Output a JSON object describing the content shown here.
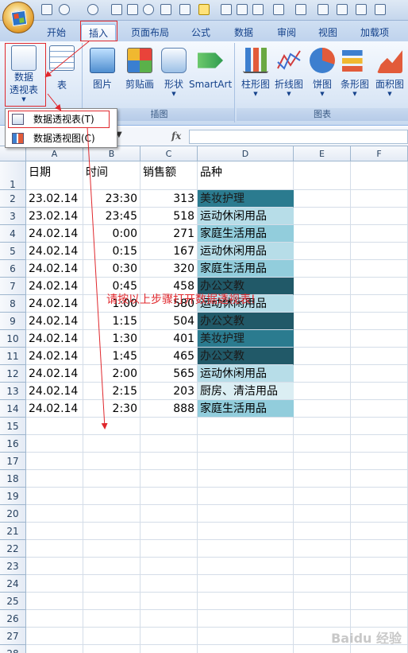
{
  "ribbon_tabs": [
    "开始",
    "插入",
    "页面布局",
    "公式",
    "数据",
    "审阅",
    "视图",
    "加载项"
  ],
  "active_tab": "插入",
  "groups": {
    "tables": {
      "pivot_label_1": "数据",
      "pivot_label_2": "透视表",
      "table_label": "表"
    },
    "illustrations": {
      "label": "插图",
      "items": [
        "图片",
        "剪贴画",
        "形状",
        "SmartArt"
      ]
    },
    "charts": {
      "label": "图表",
      "items": [
        "柱形图",
        "折线图",
        "饼图",
        "条形图",
        "面积图"
      ]
    }
  },
  "dropdown": {
    "items": [
      "数据透视表(T)",
      "数据透视图(C)"
    ]
  },
  "formula_bar": {
    "fx": "fx",
    "value": ""
  },
  "columns": [
    "A",
    "B",
    "C",
    "D",
    "E",
    "F"
  ],
  "sheet": {
    "header": [
      "日期",
      "时间",
      "销售额",
      "品种"
    ],
    "rows": [
      [
        "23.02.14",
        "23:30",
        "313",
        "美妆护理"
      ],
      [
        "23.02.14",
        "23:45",
        "518",
        "运动休闲用品"
      ],
      [
        "24.02.14",
        "0:00",
        "271",
        "家庭生活用品"
      ],
      [
        "24.02.14",
        "0:15",
        "167",
        "运动休闲用品"
      ],
      [
        "24.02.14",
        "0:30",
        "320",
        "家庭生活用品"
      ],
      [
        "24.02.14",
        "0:45",
        "458",
        "办公文教"
      ],
      [
        "24.02.14",
        "1:00",
        "580",
        "运动休闲用品"
      ],
      [
        "24.02.14",
        "1:15",
        "504",
        "办公文教"
      ],
      [
        "24.02.14",
        "1:30",
        "401",
        "美妆护理"
      ],
      [
        "24.02.14",
        "1:45",
        "465",
        "办公文教"
      ],
      [
        "24.02.14",
        "2:00",
        "565",
        "运动休闲用品"
      ],
      [
        "24.02.14",
        "2:15",
        "203",
        "厨房、清洁用品"
      ],
      [
        "24.02.14",
        "2:30",
        "888",
        "家庭生活用品"
      ]
    ],
    "row_count": 28
  },
  "annotation": "请按以上步骤打开数据透视表!",
  "watermark": "Baidu 经验",
  "colors": {
    "accent_red": "#e0282d",
    "cat_beauty": "#2b7b8f",
    "cat_sports": "#b7dde8",
    "cat_home": "#92cddc",
    "cat_office": "#215968",
    "cat_kitchen": "#dbeef3",
    "ribbon_blue": "#15428b"
  }
}
